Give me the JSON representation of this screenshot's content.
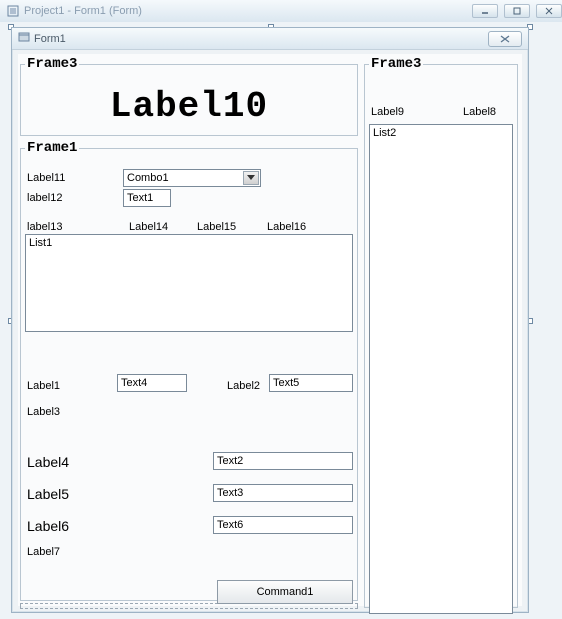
{
  "outer_window": {
    "title": "Project1 - Form1 (Form)"
  },
  "form_window": {
    "title": "Form1"
  },
  "frames": {
    "top": "Frame3",
    "left": "Frame1",
    "right": "Frame3"
  },
  "big_label": "Label10",
  "frame1": {
    "label11": "Label11",
    "combo1": "Combo1",
    "label12": "label12",
    "text1": "Text1",
    "col_headers": {
      "c1": "label13",
      "c2": "Label14",
      "c3": "Label15",
      "c4": "Label16"
    },
    "list1": "List1",
    "label1": "Label1",
    "text4": "Text4",
    "label2": "Label2",
    "text5": "Text5",
    "label3": "Label3",
    "label4": "Label4",
    "text2": "Text2",
    "label5": "Label5",
    "text3": "Text3",
    "label6": "Label6",
    "text6": "Text6",
    "label7": "Label7",
    "command1": "Command1"
  },
  "right_frame": {
    "label9": "Label9",
    "label8": "Label8",
    "list2": "List2"
  }
}
